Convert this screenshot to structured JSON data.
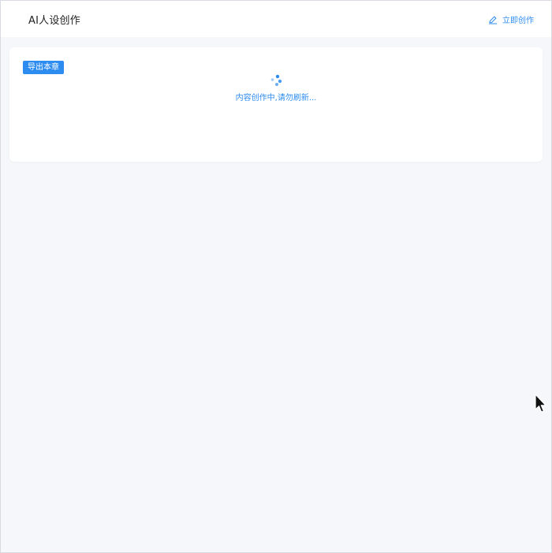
{
  "header": {
    "title": "AI人设创作",
    "create_action_label": "立即创作",
    "create_action_icon": "edit-pen-icon"
  },
  "content_card": {
    "export_button_label": "导出本章",
    "loading_text": "内容创作中,请勿刷新..."
  },
  "colors": {
    "accent": "#2d8cf0",
    "page_background": "#f5f7fa",
    "card_background": "#ffffff"
  }
}
